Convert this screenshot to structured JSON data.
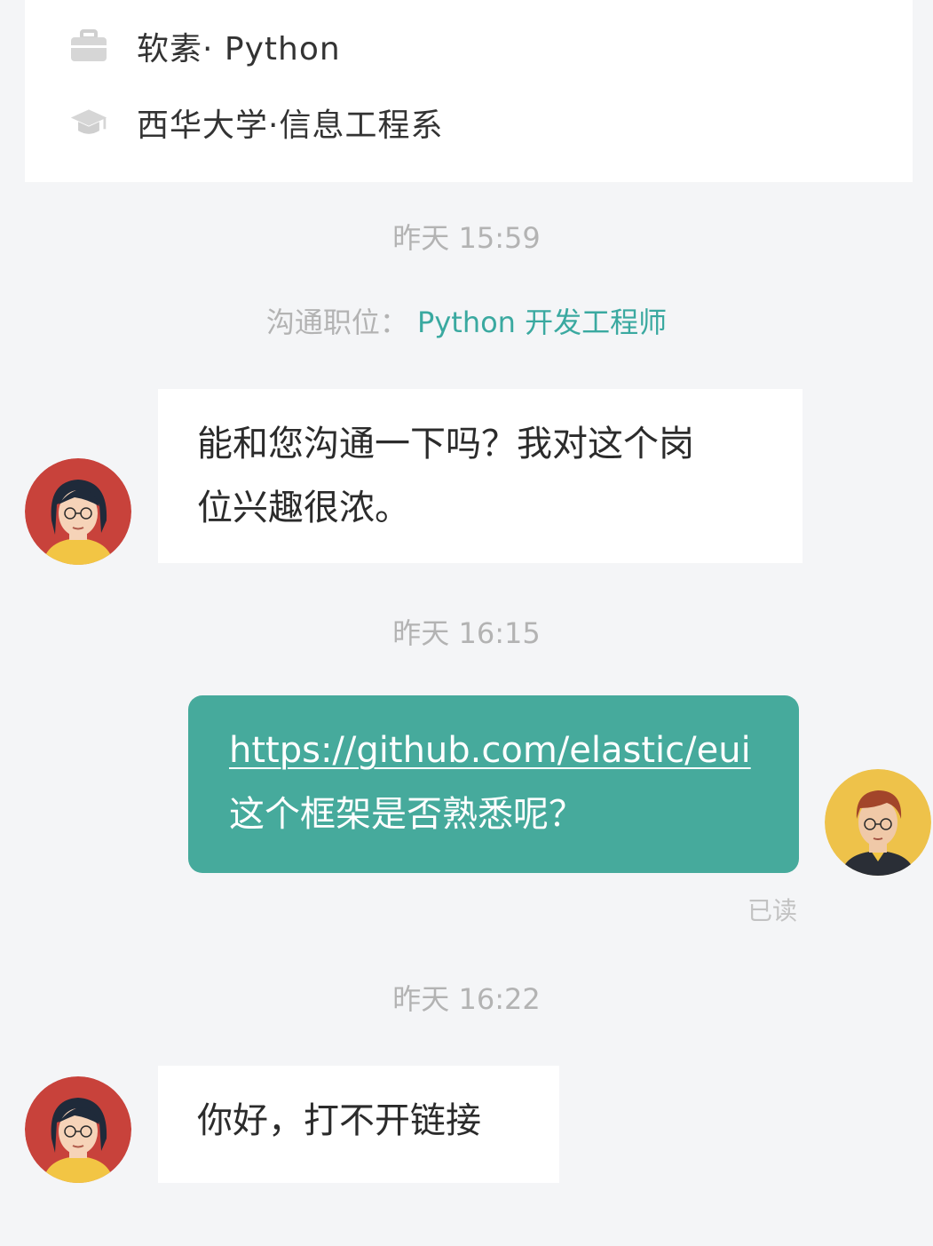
{
  "profile": {
    "job_line": "软素· Python",
    "school_line": "西华大学·信息工程系",
    "job_icon": "briefcase-icon",
    "school_icon": "graduation-cap-icon"
  },
  "conversation": {
    "position": {
      "label": "沟通职位：",
      "value": "Python  开发工程师"
    },
    "messages": [
      {
        "timestamp": "昨天 15:59",
        "sender": "candidate",
        "lines": [
          "能和您沟通一下吗？我对这个岗",
          "位兴趣很浓。"
        ]
      },
      {
        "timestamp": "昨天 16:15",
        "sender": "recruiter",
        "link": "https://github.com/elastic/eui",
        "text": "这个框架是否熟悉呢？",
        "status": "已读"
      },
      {
        "timestamp": "昨天 16:22",
        "sender": "candidate",
        "lines": [
          "你好，打不开链接"
        ]
      }
    ]
  },
  "colors": {
    "accent": "#46aa9c",
    "background": "#f4f5f7",
    "timestamp": "#b3b3b3"
  }
}
